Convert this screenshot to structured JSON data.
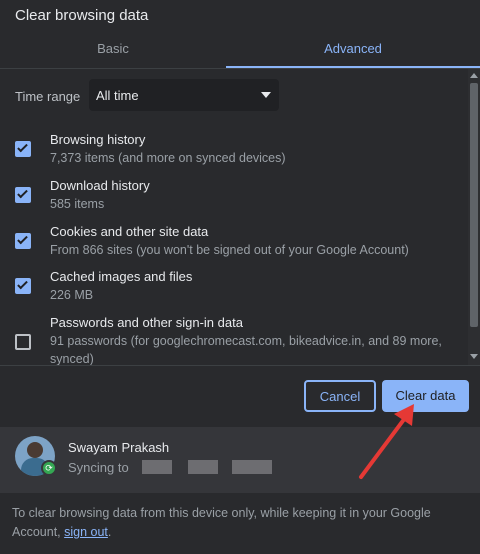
{
  "dialog": {
    "title": "Clear browsing data",
    "tabs": [
      {
        "label": "Basic"
      },
      {
        "label": "Advanced"
      }
    ]
  },
  "time_range": {
    "label": "Time range",
    "value": "All time"
  },
  "items": [
    {
      "title": "Browsing history",
      "subtitle": "7,373 items (and more on synced devices)",
      "checked": true
    },
    {
      "title": "Download history",
      "subtitle": "585 items",
      "checked": true
    },
    {
      "title": "Cookies and other site data",
      "subtitle": "From 866 sites (you won't be signed out of your Google Account)",
      "checked": true
    },
    {
      "title": "Cached images and files",
      "subtitle": "226 MB",
      "checked": true
    },
    {
      "title": "Passwords and other sign-in data",
      "subtitle": "91 passwords (for googlechromecast.com, bikeadvice.in, and 89 more,",
      "subtitle_2": "synced)",
      "checked": false
    }
  ],
  "buttons": {
    "cancel": "Cancel",
    "clear": "Clear data"
  },
  "account": {
    "name": "Swayam Prakash",
    "sync_text": "Syncing to"
  },
  "footer": {
    "text": "To clear browsing data from this device only, while keeping it in your Google Account,",
    "link": "sign out",
    "end": "."
  },
  "colors": {
    "accent": "#8ab4f8",
    "background": "#292a2d",
    "annotation_arrow": "#e53935"
  }
}
